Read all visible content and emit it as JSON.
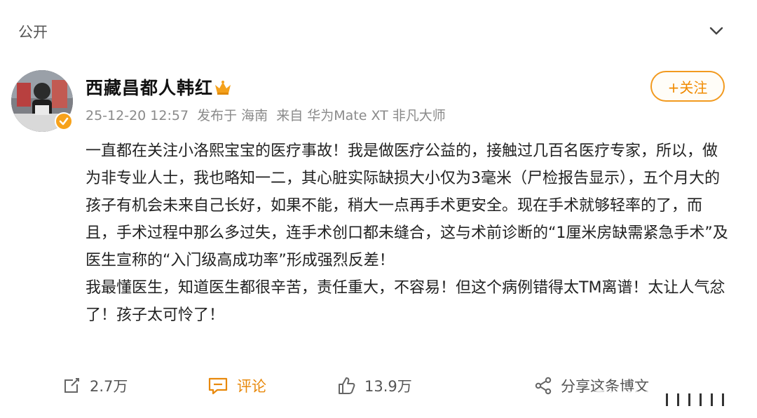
{
  "header": {
    "visibility": "公开",
    "collapse_icon": "chevron-down-icon"
  },
  "post": {
    "author": "西藏昌都人韩红",
    "author_badge": "crown-icon",
    "follow_label": "+关注",
    "date": "25-12-20 12:57",
    "location": "发布于 海南",
    "source": "来自 华为Mate XT 非凡大师",
    "paragraphs": [
      "一直都在关注小洛熙宝宝的医疗事故！我是做医疗公益的，接触过几百名医疗专家，所以，做为非专业人士，我也略知一二，其心脏实际缺损大小仅为3毫米（尸检报告显示），五个月大的孩子有机会未来自己长好，如果不能，稍大一点再手术更安全。现在手术就够轻率的了，而且，手术过程中那么多过失，连手术创口都未缝合，这与术前诊断的“1厘米房缺需紧急手术”及医生宣称的“入门级高成功率”形成强烈反差！",
      "我最懂医生，知道医生都很辛苦，责任重大，不容易！但这个病例错得太TM离谱！太让人气忿了！孩子太可怜了！"
    ]
  },
  "actions": {
    "share_count": "2.7万",
    "comment_label": "评论",
    "like_count": "13.9万",
    "share_to_label": "分享这条博文"
  },
  "colors": {
    "accent": "#f08a00",
    "meta_text": "#8a8a8a"
  }
}
